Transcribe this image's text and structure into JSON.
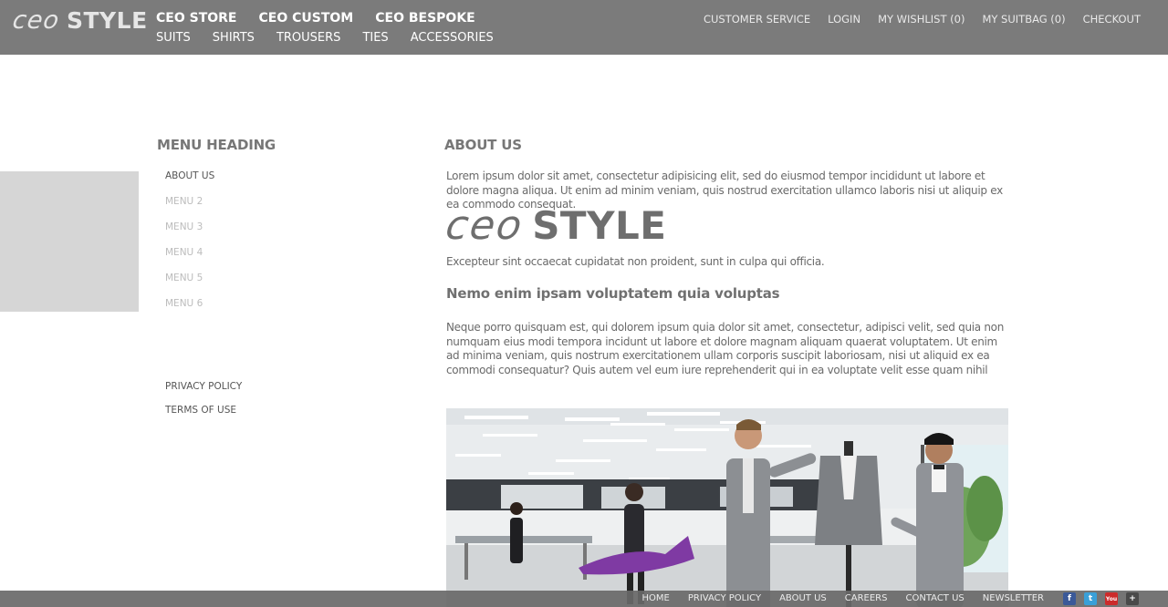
{
  "brand": {
    "logo_ceo": "ceo",
    "logo_style": "STYLE"
  },
  "nav": {
    "primary": [
      {
        "label": "CEO STORE"
      },
      {
        "label": "CEO CUSTOM"
      },
      {
        "label": "CEO BESPOKE"
      }
    ],
    "secondary": [
      {
        "label": "SUITS"
      },
      {
        "label": "SHIRTS"
      },
      {
        "label": "TROUSERS"
      },
      {
        "label": "TIES"
      },
      {
        "label": "ACCESSORIES"
      }
    ],
    "utility": [
      {
        "label": "CUSTOMER SERVICE"
      },
      {
        "label": "LOGIN"
      },
      {
        "label": "MY WISHLIST (0)"
      },
      {
        "label": "MY SUITBAG (0)"
      },
      {
        "label": "CHECKOUT"
      }
    ]
  },
  "sidebar": {
    "heading": "MENU HEADING",
    "items": [
      {
        "label": "ABOUT US"
      },
      {
        "label": "MENU 2"
      },
      {
        "label": "MENU 3"
      },
      {
        "label": "MENU 4"
      },
      {
        "label": "MENU 5"
      },
      {
        "label": "MENU 6"
      }
    ],
    "legal": [
      {
        "label": "PRIVACY POLICY"
      },
      {
        "label": "TERMS OF USE"
      }
    ]
  },
  "main": {
    "title": "ABOUT US",
    "paragraph1": "Lorem ipsum dolor sit amet, consectetur adipisicing elit, sed do eiusmod tempor incididunt ut labore et dolore magna aliqua. Ut enim ad minim veniam, quis nostrud exercitation ullamco laboris nisi ut aliquip ex ea commodo consequat.",
    "logo_ceo": "ceo",
    "logo_style": "STYLE",
    "paragraph2": "Excepteur sint occaecat cupidatat non proident, sunt in culpa qui officia.",
    "subheading": "Nemo enim ipsam voluptatem quia voluptas",
    "paragraph3": "Neque porro quisquam est, qui dolorem ipsum quia dolor sit amet, consectetur, adipisci velit, sed quia non numquam eius modi tempora incidunt ut labore et dolore magnam aliquam quaerat voluptatem. Ut enim ad minima veniam, quis nostrum exercitationem ullam corporis suscipit laboriosam, nisi ut aliquid ex ea commodi consequatur? Quis autem vel eum iure reprehenderit qui in ea voluptate velit esse quam nihil"
  },
  "footer": {
    "links": [
      {
        "label": "HOME"
      },
      {
        "label": "PRIVACY POLICY"
      },
      {
        "label": "ABOUT US"
      },
      {
        "label": "CAREERS"
      },
      {
        "label": "CONTACT US"
      },
      {
        "label": "NEWSLETTER"
      }
    ],
    "social": [
      {
        "icon": "facebook-icon",
        "glyph": "f",
        "color": "#3b5998"
      },
      {
        "icon": "twitter-icon",
        "glyph": "t",
        "color": "#3aa0d8"
      },
      {
        "icon": "youtube-icon",
        "glyph": "You",
        "color": "#cc2b2b"
      },
      {
        "icon": "googleplus-icon",
        "glyph": "+",
        "color": "#4a4a4a"
      }
    ]
  },
  "colors": {
    "header_bg": "#7b7b7b",
    "footer_bg": "#696969",
    "gray_block": "#d6d6d6"
  }
}
